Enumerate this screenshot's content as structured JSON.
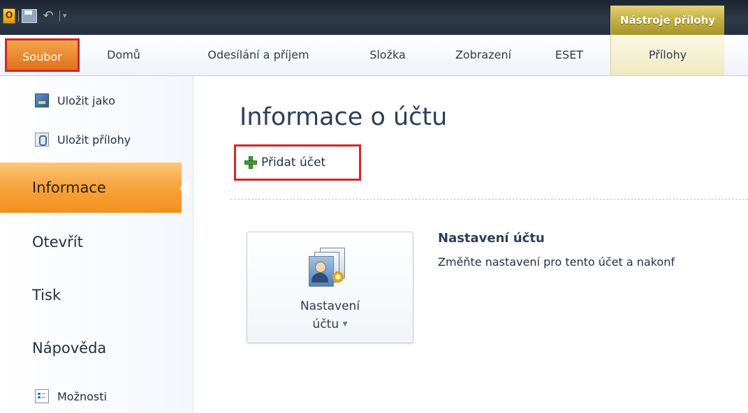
{
  "ribbon": {
    "context_group": "Nástroje přílohy",
    "tabs": [
      "Soubor",
      "Domů",
      "Odesílání a příjem",
      "Složka",
      "Zobrazení",
      "ESET",
      "Přílohy"
    ]
  },
  "backstage": {
    "commands_top": [
      "Uložit jako",
      "Uložit přílohy"
    ],
    "nav": [
      "Informace",
      "Otevřít",
      "Tisk",
      "Nápověda"
    ],
    "active_nav": "Informace",
    "command_bottom": "Možnosti"
  },
  "main": {
    "title": "Informace o účtu",
    "add_account": "Přidat účet",
    "account_settings_button_line1": "Nastavení",
    "account_settings_button_line2": "účtu",
    "settings_heading": "Nastavení účtu",
    "settings_description": "Změňte nastavení pro tento účet a nakonf"
  },
  "colors": {
    "file_tab": "#e0711a",
    "highlight_border": "#d8242b",
    "active_nav": "#f7a53f",
    "context_tab": "#c9b548"
  }
}
